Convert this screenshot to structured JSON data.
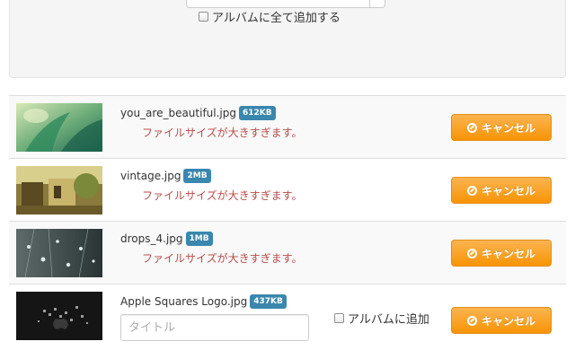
{
  "top": {
    "add_all_label": "アルバムに全て追加する"
  },
  "files": [
    {
      "name": "you_are_beautiful.jpg",
      "size": "612KB",
      "error": "ファイルサイズが大きすぎます。",
      "cancel_label": "キャンセル"
    },
    {
      "name": "vintage.jpg",
      "size": "2MB",
      "error": "ファイルサイズが大きすぎます。",
      "cancel_label": "キャンセル"
    },
    {
      "name": "drops_4.jpg",
      "size": "1MB",
      "error": "ファイルサイズが大きすぎます。",
      "cancel_label": "キャンセル"
    },
    {
      "name": "Apple Squares Logo.jpg",
      "size": "437KB",
      "title_placeholder": "タイトル",
      "title_value": "",
      "add_album_label": "アルバムに追加",
      "cancel_label": "キャンセル"
    }
  ],
  "colors": {
    "badge": "#3a87ad",
    "error": "#b94a48",
    "cancel_button": "#f89406"
  },
  "icons": {
    "cancel": "ban-icon"
  }
}
